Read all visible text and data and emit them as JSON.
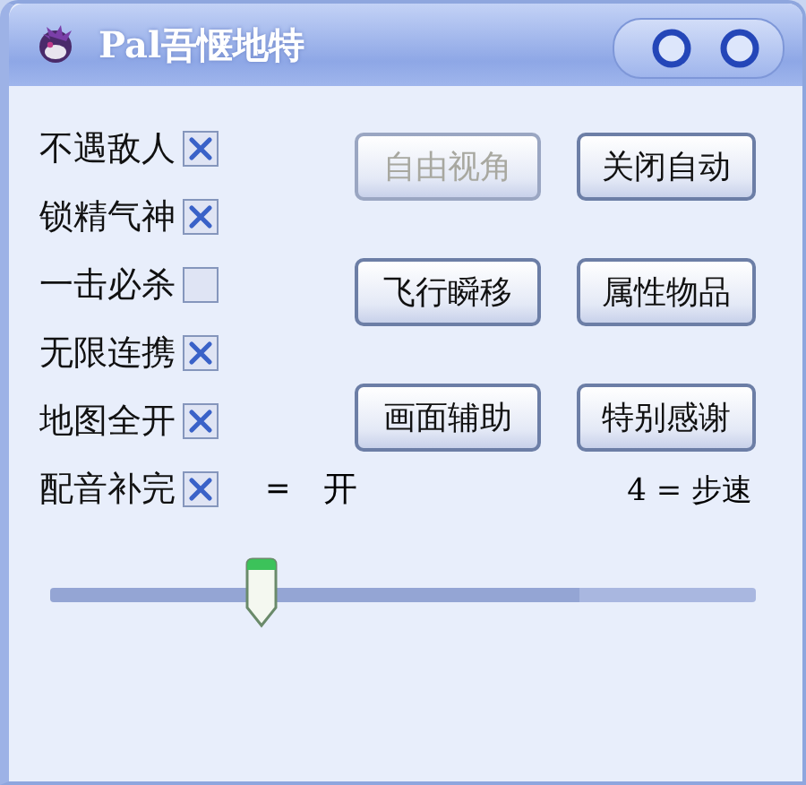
{
  "window": {
    "title": "Pal吾惬地特"
  },
  "options": [
    {
      "label": "不遇敌人",
      "checked": true
    },
    {
      "label": "锁精气神",
      "checked": true
    },
    {
      "label": "一击必杀",
      "checked": false
    },
    {
      "label": "无限连携",
      "checked": true
    },
    {
      "label": "地图全开",
      "checked": true
    },
    {
      "label": "配音补完",
      "checked": true
    }
  ],
  "buttons": [
    {
      "label": "自由视角",
      "disabled": true
    },
    {
      "label": "关闭自动",
      "disabled": false
    },
    {
      "label": "飞行瞬移",
      "disabled": false
    },
    {
      "label": "属性物品",
      "disabled": false
    },
    {
      "label": "画面辅助",
      "disabled": false
    },
    {
      "label": "特别感谢",
      "disabled": false
    }
  ],
  "status": {
    "equals": "=",
    "state": "开",
    "speed": "4 = 步速"
  },
  "slider": {
    "level": 0.3
  }
}
